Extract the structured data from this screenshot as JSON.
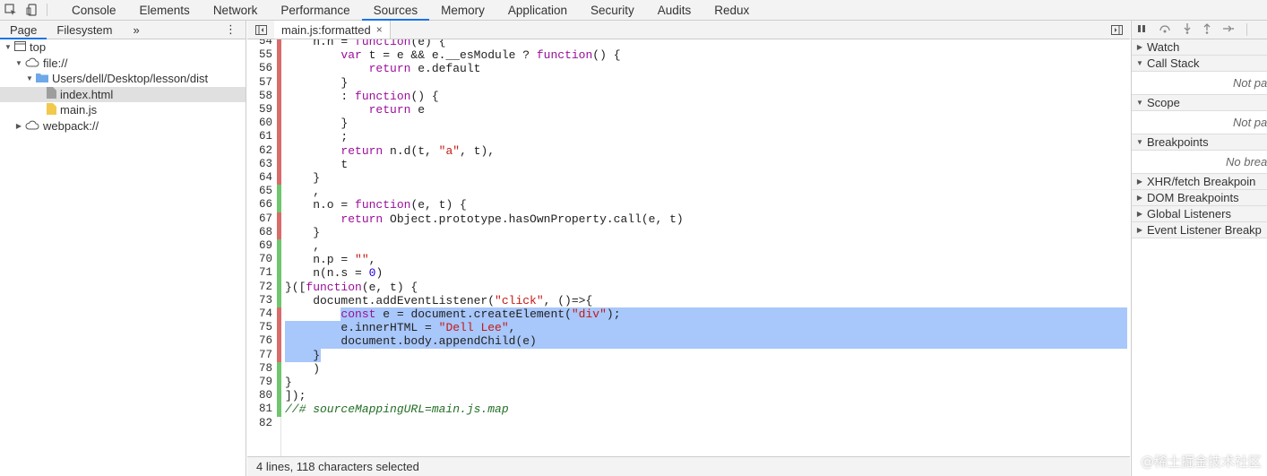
{
  "topbar": {
    "tabs": [
      "Console",
      "Elements",
      "Network",
      "Performance",
      "Sources",
      "Memory",
      "Application",
      "Security",
      "Audits",
      "Redux"
    ],
    "active_tab": "Sources",
    "inspect_icon": "inspect-element-icon",
    "device_icon": "device-toolbar-icon"
  },
  "navigator": {
    "tabs": [
      "Page",
      "Filesystem"
    ],
    "more_label": "»",
    "menu_icon": "⋮",
    "tree": {
      "top": "top",
      "file_origin": "file://",
      "folder": "Users/dell/Desktop/lesson/dist",
      "file1": "index.html",
      "file2": "main.js",
      "webpack": "webpack://"
    }
  },
  "editor": {
    "tab_label": "main.js:formatted",
    "close_label": "×",
    "lines": [
      {
        "n": "54",
        "text": "    n.n = function(e) {"
      },
      {
        "n": "55",
        "text": "        var t = e && e.__esModule ? function() {"
      },
      {
        "n": "56",
        "text": "            return e.default"
      },
      {
        "n": "57",
        "text": "        }"
      },
      {
        "n": "58",
        "text": "        : function() {"
      },
      {
        "n": "59",
        "text": "            return e"
      },
      {
        "n": "60",
        "text": "        }"
      },
      {
        "n": "61",
        "text": "        ;"
      },
      {
        "n": "62",
        "text": "        return n.d(t, \"a\", t),"
      },
      {
        "n": "63",
        "text": "        t"
      },
      {
        "n": "64",
        "text": "    }"
      },
      {
        "n": "65",
        "text": "    ,"
      },
      {
        "n": "66",
        "text": "    n.o = function(e, t) {"
      },
      {
        "n": "67",
        "text": "        return Object.prototype.hasOwnProperty.call(e, t)"
      },
      {
        "n": "68",
        "text": "    }"
      },
      {
        "n": "69",
        "text": "    ,"
      },
      {
        "n": "70",
        "text": "    n.p = \"\","
      },
      {
        "n": "71",
        "text": "    n(n.s = 0)"
      },
      {
        "n": "72",
        "text": "}([function(e, t) {"
      },
      {
        "n": "73",
        "text": "    document.addEventListener(\"click\", ()=>{"
      },
      {
        "n": "74",
        "text": "        const e = document.createElement(\"div\");"
      },
      {
        "n": "75",
        "text": "        e.innerHTML = \"Dell Lee\","
      },
      {
        "n": "76",
        "text": "        document.body.appendChild(e)"
      },
      {
        "n": "77",
        "text": "    }"
      },
      {
        "n": "78",
        "text": "    )"
      },
      {
        "n": "79",
        "text": "}"
      },
      {
        "n": "80",
        "text": "]);"
      },
      {
        "n": "81",
        "text": "//# sourceMappingURL=main.js.map"
      },
      {
        "n": "82",
        "text": ""
      }
    ],
    "status_text": "4 lines, 118 characters selected"
  },
  "debugger": {
    "sections": {
      "watch": "Watch",
      "call_stack": "Call Stack",
      "call_stack_empty": "Not paus",
      "scope": "Scope",
      "scope_empty": "Not paus",
      "breakpoints": "Breakpoints",
      "breakpoints_empty": "No breakp",
      "xhr": "XHR/fetch Breakpoin",
      "dom": "DOM Breakpoints",
      "global": "Global Listeners",
      "event": "Event Listener Breakp"
    }
  },
  "watermark": "@稀土掘金技术社区",
  "colors": {
    "accent": "#1a73e8",
    "selection": "#a8c7fa",
    "keyword": "#9a0e9a",
    "string": "#c41a16",
    "number": "#1c00cf",
    "comment": "#236e25",
    "diff_red": "#d96b6b",
    "diff_green": "#6ec66e"
  }
}
